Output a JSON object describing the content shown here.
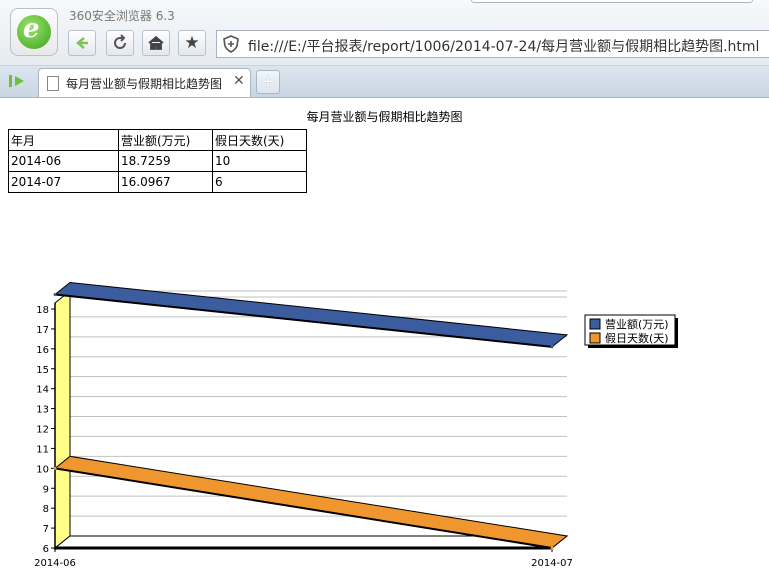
{
  "browser": {
    "app_title": "360安全浏览器 6.3",
    "url": "file:///E:/平台报表/report/1006/2014-07-24/每月营业额与假期相比趋势图.html",
    "tab_label": "每月营业额与假期相比趋势图",
    "icons": [
      "browser-logo-icon",
      "back-icon",
      "refresh-icon",
      "home-icon",
      "favorite-star-icon",
      "security-shield-icon",
      "page-icon",
      "close-icon",
      "new-tab-icon",
      "sidebar-toggle-icon"
    ]
  },
  "page": {
    "title": "每月营业额与假期相比趋势图",
    "table": {
      "headers": [
        "年月",
        "营业额(万元)",
        "假日天数(天)"
      ],
      "rows": [
        [
          "2014-06",
          "18.7259",
          "10"
        ],
        [
          "2014-07",
          "16.0967",
          "6"
        ]
      ]
    }
  },
  "chart_data": {
    "type": "line",
    "title": "",
    "xlabel": "",
    "ylabel": "",
    "categories": [
      "2014-06",
      "2014-07"
    ],
    "series": [
      {
        "name": "营业额(万元)",
        "values": [
          18.7259,
          16.0967
        ],
        "color": "#3b5c9e"
      },
      {
        "name": "假日天数(天)",
        "values": [
          10,
          6
        ],
        "color": "#f0962e"
      }
    ],
    "ylim": [
      6,
      18
    ],
    "y_ticks": [
      6,
      7,
      8,
      9,
      10,
      11,
      12,
      13,
      14,
      15,
      16,
      17,
      18
    ],
    "style": "3d",
    "grid": true,
    "legend": "right",
    "wall_color": "#ffff88"
  }
}
